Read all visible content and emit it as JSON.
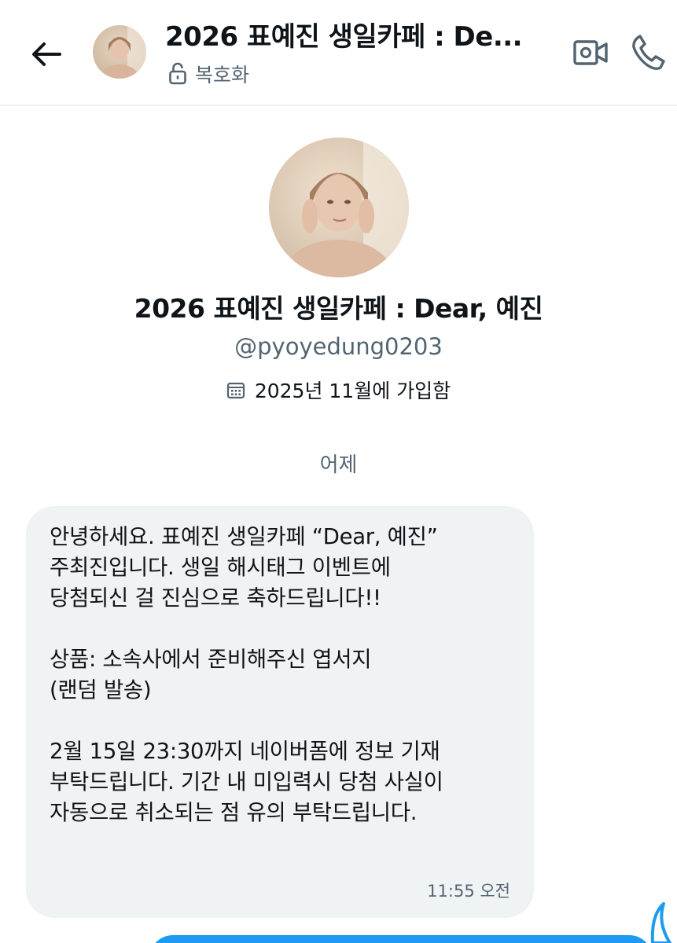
{
  "header": {
    "title": "2026 표예진 생일카페 : De...",
    "encryption_label": "복호화",
    "back_icon": "arrow-left-icon",
    "lock_icon": "unlock-icon",
    "video_icon": "video-camera-icon",
    "call_icon": "phone-icon"
  },
  "profile": {
    "name": "2026 표예진 생일카페 : Dear, 예진",
    "handle": "@pyoyedung0203",
    "joined": "2025년 11월에 가입함",
    "calendar_icon": "calendar-icon"
  },
  "conversation": {
    "date_divider": "어제",
    "messages": [
      {
        "lines": [
          "안녕하세요. 표예진 생일카페 “Dear, 예진”",
          "주최진입니다. 생일 해시태그 이벤트에",
          "당첨되신 걸 진심으로 축하드립니다!!",
          "",
          "상품: 소속사에서 준비해주신 엽서지",
          "(랜덤 발송)",
          "",
          "2월 15일 23:30까지 네이버폼에 정보 기재",
          "부탁드립니다. 기간 내 미입력시 당첨 사실이",
          "자동으로 취소되는 점 유의 부탁드립니다."
        ],
        "time": "11:55 오전"
      }
    ]
  },
  "colors": {
    "text_primary": "#0f1419",
    "text_secondary": "#536471",
    "bubble_received": "#eff3f4",
    "bubble_sent": "#1d9bf0",
    "divider": "#eff3f4"
  }
}
